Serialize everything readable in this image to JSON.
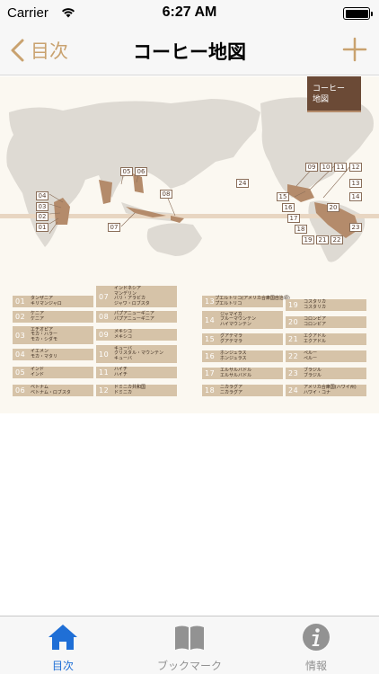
{
  "status_bar": {
    "carrier": "Carrier",
    "time": "6:27 AM"
  },
  "nav": {
    "back_label": "目次",
    "title": "コーヒー地図"
  },
  "map": {
    "badge_line1": "コーヒー",
    "badge_line2": "地図",
    "tags": [
      "01",
      "02",
      "03",
      "04",
      "05",
      "06",
      "07",
      "08",
      "09",
      "10",
      "11",
      "12",
      "13",
      "14",
      "15",
      "16",
      "17",
      "18",
      "19",
      "20",
      "21",
      "22",
      "23",
      "24"
    ]
  },
  "legend": {
    "col1": [
      {
        "num": "01",
        "text": "タンザニア\nキリマンジャロ"
      },
      {
        "num": "02",
        "text": "ケニア\nケニア"
      },
      {
        "num": "03",
        "text": "エチオピア\nモカ・ハラー\nモカ・シダモ"
      },
      {
        "num": "04",
        "text": "イエメン\nモカ・マタリ"
      },
      {
        "num": "05",
        "text": "インド\nインド"
      },
      {
        "num": "06",
        "text": "ベトナム\nベトナム・ロブスタ"
      }
    ],
    "col2": [
      {
        "num": "07",
        "text": "インドネシア\nマンデリン\nバリ・アラビカ\nジャワ・ロブスタ"
      },
      {
        "num": "08",
        "text": "パプアニューギニア\nパプアニューギニア"
      },
      {
        "num": "09",
        "text": "メキシコ\nメキシコ"
      },
      {
        "num": "10",
        "text": "キューバ\nクリスタル・マウンテン\nキューバ"
      },
      {
        "num": "11",
        "text": "ハイチ\nハイチ"
      },
      {
        "num": "12",
        "text": "ドミニカ共和国\nドミニカ"
      }
    ],
    "col3": [
      {
        "num": "13",
        "text": "プエルトリコ(アメリカ合衆国自治領)\nプエルトリコ"
      },
      {
        "num": "14",
        "text": "ジャマイカ\nブルーマウンテン\nハイマウンテン"
      },
      {
        "num": "15",
        "text": "グアテマラ\nグアテマラ"
      },
      {
        "num": "16",
        "text": "ホンジュラス\nホンジュラス"
      },
      {
        "num": "17",
        "text": "エルサルバドル\nエルサルバドル"
      },
      {
        "num": "18",
        "text": "ニカラグア\nニカラグア"
      }
    ],
    "col4": [
      {
        "num": "19",
        "text": "コスタリカ\nコスタリカ"
      },
      {
        "num": "20",
        "text": "コロンビア\nコロンビア"
      },
      {
        "num": "21",
        "text": "エクアドル\nエクアドル"
      },
      {
        "num": "22",
        "text": "ペルー\nペルー"
      },
      {
        "num": "23",
        "text": "ブラジル\nブラジル"
      },
      {
        "num": "24",
        "text": "アメリカ合衆国(ハワイ州)\nハワイ・コナ"
      }
    ]
  },
  "tabs": [
    {
      "label": "目次",
      "icon": "home-icon",
      "active": true
    },
    {
      "label": "ブックマーク",
      "icon": "book-icon",
      "active": false
    },
    {
      "label": "情報",
      "icon": "info-icon",
      "active": false
    }
  ],
  "colors": {
    "accent": "#c9a26f",
    "tab_active": "#1f6fd6",
    "badge": "#6b4a36",
    "legend_bg": "#d6c3a8",
    "land": "#dedad3",
    "coffee_region": "#b48b6b"
  }
}
